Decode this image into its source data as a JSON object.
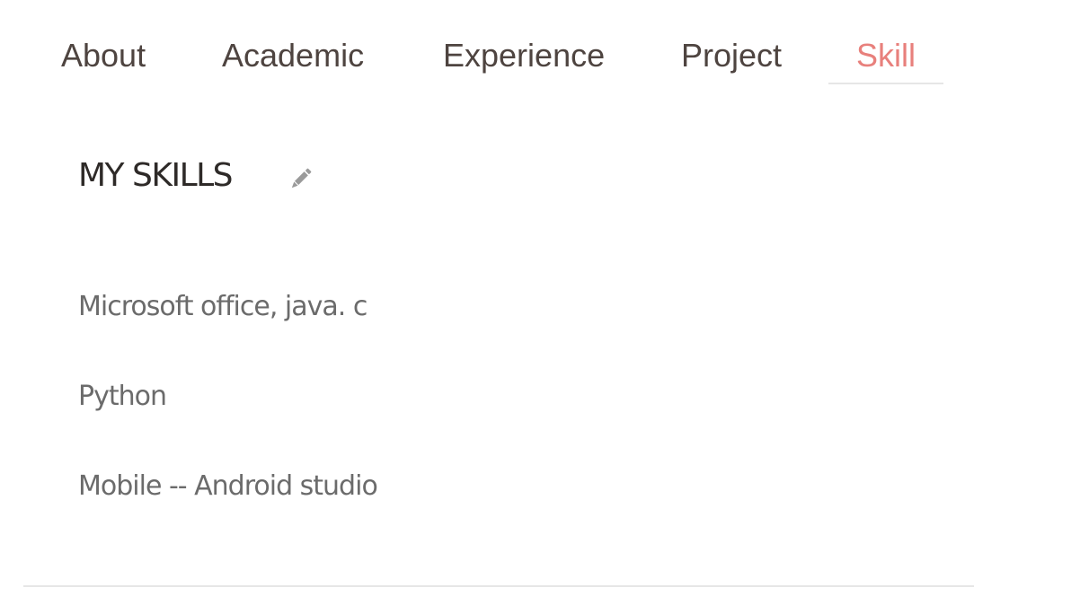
{
  "tabs": [
    {
      "label": "About"
    },
    {
      "label": "Academic"
    },
    {
      "label": "Experience"
    },
    {
      "label": "Project"
    },
    {
      "label": "Skill"
    }
  ],
  "active_tab": "Skill",
  "section": {
    "title": "MY SKILLS",
    "edit_icon": "pencil-icon"
  },
  "skills": [
    {
      "text": "Microsoft office, java. c"
    },
    {
      "text": "Python"
    },
    {
      "text": "Mobile -- Android studio"
    }
  ],
  "colors": {
    "active_tab": "#e8807c",
    "tab_text": "#4e4440",
    "title_text": "#2e2a28",
    "body_text": "#6b6b6b",
    "divider": "#e6e6e6",
    "icon": "#9a9a9a"
  }
}
